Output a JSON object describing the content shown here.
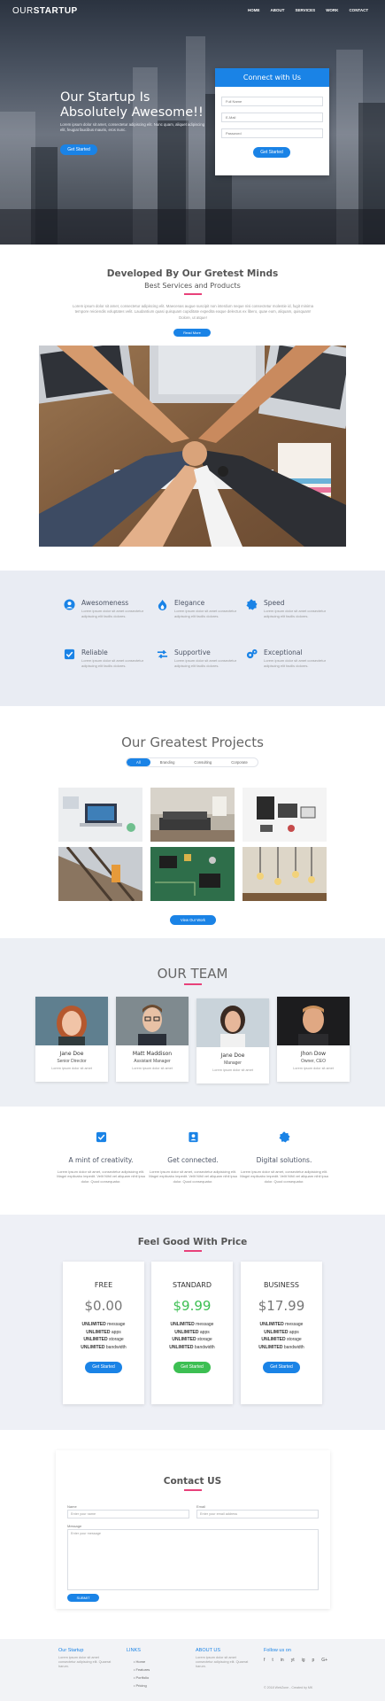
{
  "nav": {
    "logo_light": "OUR",
    "logo_bold": "STARTUP",
    "items": [
      "HOME",
      "ABOUT",
      "SERVICES",
      "WORK",
      "CONTACT"
    ]
  },
  "hero": {
    "headline": "Our Startup Is Absolutely Awesome!!",
    "subtext": "Lorem ipsum dolor sit amet, consectetur adipiscing elit. Nunc quam, aliquet adipiscing elit, feugiat faucibus mauris, eros nunc.",
    "cta": "Get Started"
  },
  "connect_form": {
    "title": "Connect with Us",
    "name_placeholder": "Full Name",
    "email_placeholder": "E-Mail",
    "password_placeholder": "Password",
    "button": "Get Started"
  },
  "developed": {
    "title": "Developed By Our Gretest Minds",
    "subtitle": "Best Services and Products",
    "text": "Lorem ipsum dolor sit amet, consectetur adipiscing elit. Maecenas augue suscipit non interdum neque nisi consectetur molestie id, fugit minima tempore reiciendis voluptates velit. Laudantium quasi quisquam cupiditate expedita eaque delectus ex libero, quae eum, aliquam, quisquam! Dolore, ut atque!",
    "button": "Read More"
  },
  "features": [
    {
      "title": "Awesomeness",
      "text": "Lorem ipsum dolor sit amet consectetur adipiscing elit facilis dolores.",
      "icon": "user-circle-icon"
    },
    {
      "title": "Elegance",
      "text": "Lorem ipsum dolor sit amet consectetur adipiscing elit facilis dolores.",
      "icon": "fire-icon"
    },
    {
      "title": "Speed",
      "text": "Lorem ipsum dolor sit amet consectetur adipiscing elit facilis dolores.",
      "icon": "gear-badge-icon"
    },
    {
      "title": "Reliable",
      "text": "Lorem ipsum dolor sit amet consectetur adipiscing elit facilis dolores.",
      "icon": "checkbox-icon"
    },
    {
      "title": "Supportive",
      "text": "Lorem ipsum dolor sit amet consectetur adipiscing elit facilis dolores.",
      "icon": "exchange-arrows-icon"
    },
    {
      "title": "Exceptional",
      "text": "Lorem ipsum dolor sit amet consectetur adipiscing elit facilis dolores.",
      "icon": "cogs-icon"
    }
  ],
  "projects": {
    "title": "Our Greatest Projects",
    "filters": [
      "All",
      "Branding",
      "Consulting",
      "Corporate"
    ],
    "button": "View Our Work"
  },
  "team": {
    "title": "OUR TEAM",
    "members": [
      {
        "name": "Jane Doe",
        "role": "Senior Director",
        "text": "Lorem ipsum dolor sit amet"
      },
      {
        "name": "Matt Maddison",
        "role": "Assistant Manager",
        "text": "Lorem ipsum dolor sit amet"
      },
      {
        "name": "Jane Doe",
        "role": "Manager",
        "text": "Lorem ipsum dolor sit amet"
      },
      {
        "name": "Jhon Dow",
        "role": "Owner, CEO",
        "text": "Lorem ipsum dolor sit amet"
      }
    ]
  },
  "values": [
    {
      "title": "A mint of creativity.",
      "text": "Lorem ipsum dolor sit amet, consectetur adipisicing elit. Magni explicabo impedit. Velit Nihil vel aliquam nihil ipsa dolor. Quod consequatur.",
      "icon": "checkbox-icon"
    },
    {
      "title": "Get connected.",
      "text": "Lorem ipsum dolor sit amet, consectetur adipisicing elit. Magni explicabo impedit. Velit Nihil vel aliquam nihil ipsa dolor. Quod consequatur.",
      "icon": "user-badge-icon"
    },
    {
      "title": "Digital solutions.",
      "text": "Lorem ipsum dolor sit amet, consectetur adipisicing elit. Magni explicabo impedit. Velit Nihil vel aliquam nihil ipsa dolor. Quod consequatur.",
      "icon": "gear-badge-icon"
    }
  ],
  "pricing": {
    "title": "Feel Good With Price",
    "plans": [
      {
        "name": "FREE",
        "price": "$0.00",
        "features": [
          "message",
          "apps",
          "storage",
          "bandwidth"
        ],
        "button": "Get Started"
      },
      {
        "name": "STANDARD",
        "price": "$9.99",
        "features": [
          "message",
          "apps",
          "storage",
          "bandwidth"
        ],
        "button": "Get Started"
      },
      {
        "name": "BUSINESS",
        "price": "$17.99",
        "features": [
          "message",
          "apps",
          "storage",
          "bandwidth"
        ],
        "button": "Get Started"
      }
    ],
    "unlimited": "UNLIMITED"
  },
  "contact": {
    "title": "Contact US",
    "name_label": "Name",
    "name_placeholder": "Enter your name",
    "email_label": "Email",
    "email_placeholder": "Enter your email address",
    "message_label": "Message",
    "message_placeholder": "Enter your message",
    "submit": "SUBMIT"
  },
  "footer": {
    "col1_title": "Our Startup",
    "col1_text": "Lorem ipsum dolor sit amet consectetur adipiscing elit. Quaerat harum.",
    "col2_title": "LINKS",
    "links": [
      "Home",
      "Features",
      "Portfolio",
      "Pricing"
    ],
    "col3_title": "ABOUT US",
    "col3_text": "Lorem ipsum dolor sit amet consectetur adipiscing elit. Quaerat harum.",
    "col4_title": "Follow us on",
    "social": [
      "f",
      "t",
      "in",
      "yt",
      "ig",
      "p",
      "G+"
    ],
    "copyright": "© 2018 WebZone - Created by MK"
  },
  "colors": {
    "accent": "#1a83e6",
    "pink": "#e8417a",
    "green": "#3cbf52"
  }
}
